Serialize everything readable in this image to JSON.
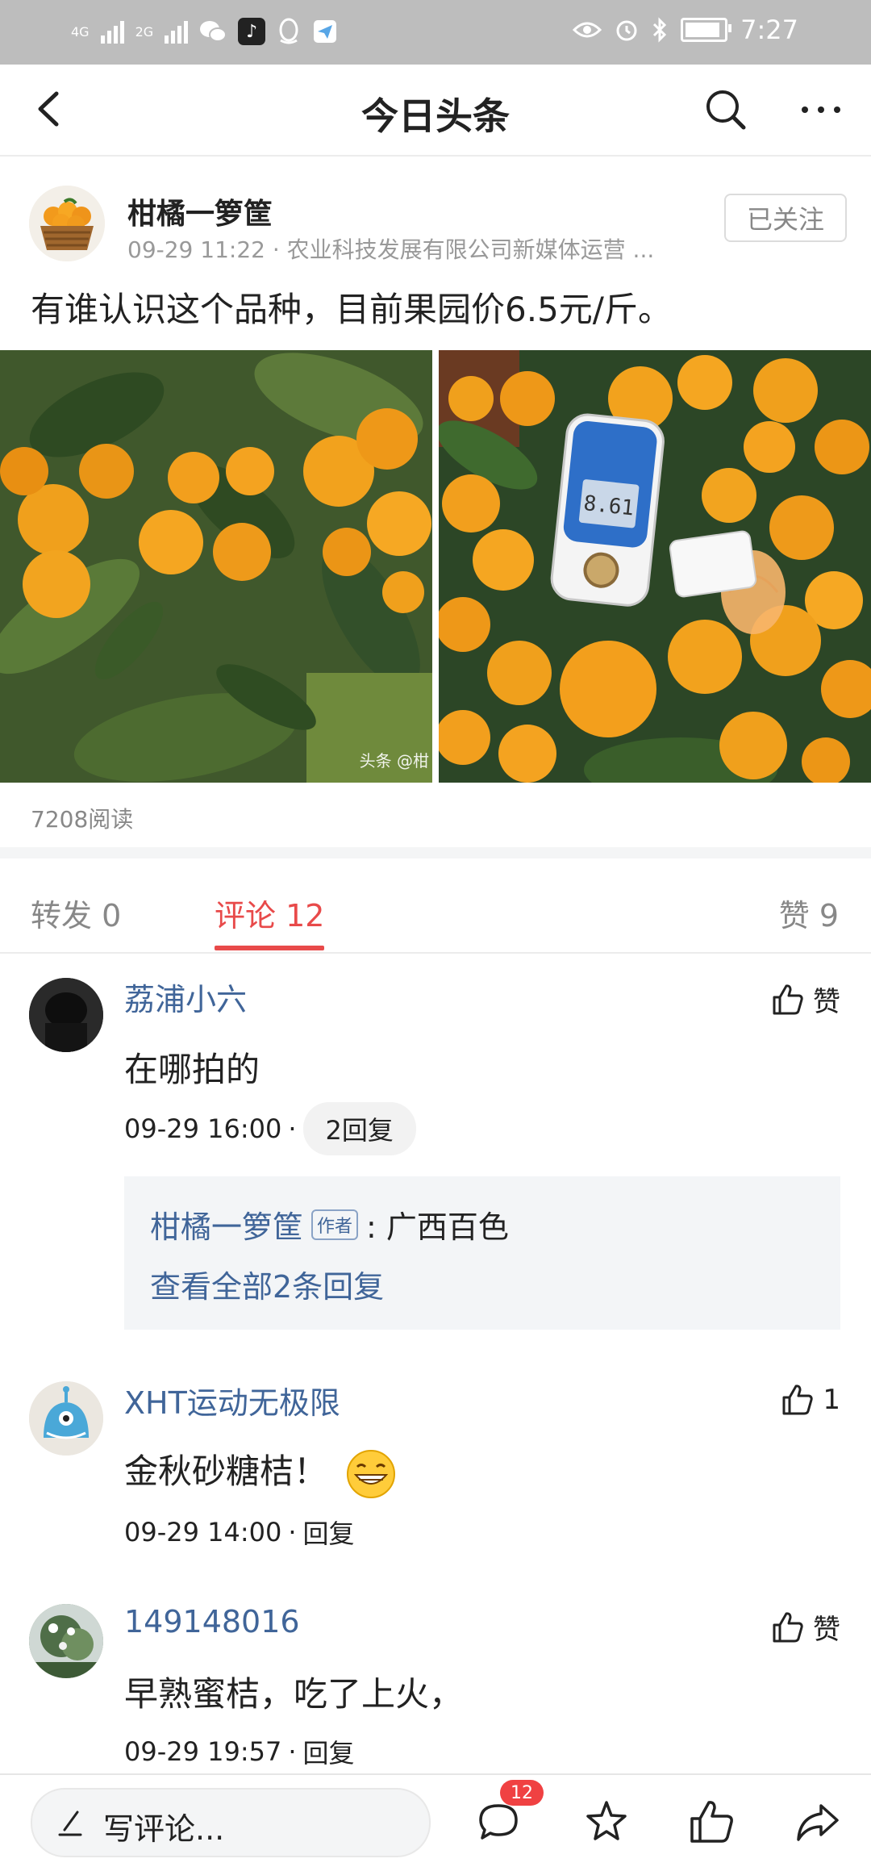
{
  "status_bar": {
    "net1": "4G",
    "net2": "2G",
    "time": "7:27"
  },
  "header": {
    "title": "今日头条"
  },
  "post": {
    "author_name": "柑橘一箩筐",
    "meta": "09-29 11:22 · 农业科技发展有限公司新媒体运营 ...",
    "follow_label": "已关注",
    "text": "有谁认识这个品种，目前果园价6.5元/斤。",
    "watermark": "头条 @柑",
    "meter_reading": "8.61",
    "read_count": "7208阅读"
  },
  "tabs": {
    "repost": "转发 0",
    "comments": "评论 12",
    "likes": "赞 9"
  },
  "comments": [
    {
      "name": "荔浦小六",
      "text": "在哪拍的",
      "time": "09-29 16:00",
      "dot": "·",
      "reply_label": "2回复",
      "like": "赞",
      "reply_author": "柑橘一箩筐",
      "author_tag": "作者",
      "reply_text": ": 广西百色",
      "reply_more": "查看全部2条回复"
    },
    {
      "name": "XHT运动无极限",
      "text": "金秋砂糖桔！",
      "time": "09-29 14:00",
      "dot": "·",
      "reply_label": "回复",
      "like": "1"
    },
    {
      "name": "149148016",
      "text": "早熟蜜桔，吃了上火，",
      "time": "09-29 19:57",
      "dot": "·",
      "reply_label": "回复",
      "like": "赞"
    }
  ],
  "bottom_bar": {
    "write_placeholder": "写评论...",
    "comment_badge": "12"
  },
  "colors": {
    "accent": "#e84a4a",
    "link": "#406599",
    "badge": "#f04142"
  }
}
